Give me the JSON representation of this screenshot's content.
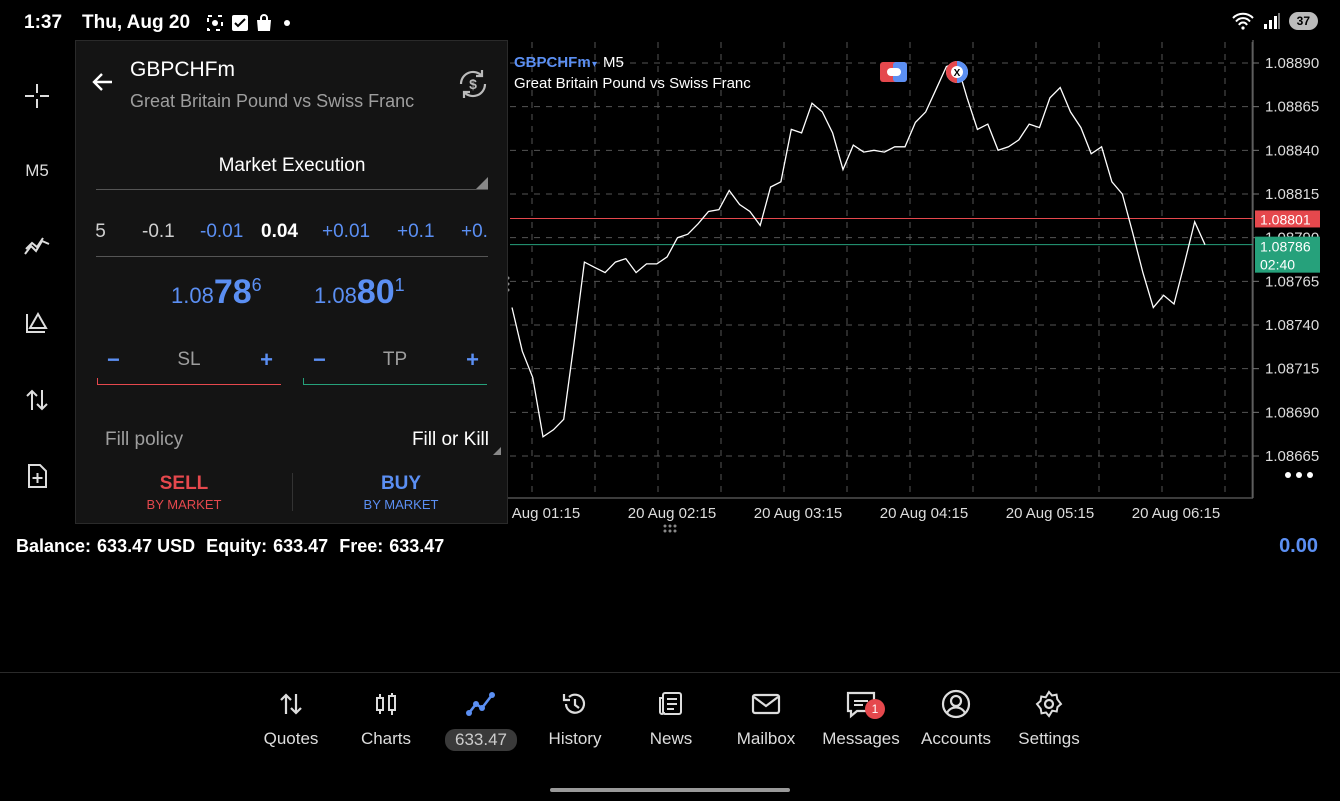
{
  "status_bar": {
    "time": "1:37",
    "date": "Thu, Aug 20",
    "battery": "37"
  },
  "toolbar": {
    "timeframe": "M5"
  },
  "order_panel": {
    "symbol": "GBPCHFm",
    "description": "Great Britain Pound vs Swiss Franc",
    "execution": "Market Execution",
    "volume_steps": [
      ".5",
      "-0.1",
      "-0.01",
      "0.04",
      "+0.01",
      "+0.1",
      "+0."
    ],
    "bid": {
      "prefix": "1.08",
      "big": "78",
      "sup": "6"
    },
    "ask": {
      "prefix": "1.08",
      "big": "80",
      "sup": "1"
    },
    "sl_label": "SL",
    "tp_label": "TP",
    "minus": "−",
    "plus": "+",
    "fill_policy_label": "Fill policy",
    "fill_policy_value": "Fill or Kill",
    "sell": {
      "label": "SELL",
      "sub": "BY MARKET"
    },
    "buy": {
      "label": "BUY",
      "sub": "BY MARKET"
    },
    "colors": {
      "sell": "#e5484d",
      "buy": "#5b8ff3",
      "sl": "#e5484d",
      "tp": "#26a17b"
    }
  },
  "chart_data": {
    "type": "line",
    "symbol": "GBPCHFm",
    "timeframe": "M5",
    "description": "Great Britain Pound vs Swiss Franc",
    "ylim": [
      1.08645,
      1.089
    ],
    "y_ticks": [
      "1.08890",
      "1.08865",
      "1.08840",
      "1.08815",
      "1.08790",
      "1.08765",
      "1.08740",
      "1.08715",
      "1.08690",
      "1.08665"
    ],
    "x_ticks": [
      "Aug 01:15",
      "20 Aug 02:15",
      "20 Aug 03:15",
      "20 Aug 04:15",
      "20 Aug 05:15",
      "20 Aug 06:15"
    ],
    "ask_price": "1.08801",
    "bid_price": "1.08786",
    "countdown": "02:40",
    "grid": true,
    "values": [
      1.0875,
      1.08725,
      1.0871,
      1.08676,
      1.0868,
      1.08686,
      1.0873,
      1.08776,
      1.08773,
      1.0877,
      1.08776,
      1.08778,
      1.0877,
      1.08775,
      1.08775,
      1.08779,
      1.0879,
      1.08792,
      1.08798,
      1.08805,
      1.08806,
      1.08817,
      1.08809,
      1.08805,
      1.08797,
      1.08819,
      1.08822,
      1.08852,
      1.0885,
      1.08867,
      1.08862,
      1.0885,
      1.08829,
      1.08843,
      1.08839,
      1.0884,
      1.08839,
      1.08842,
      1.08842,
      1.08856,
      1.08862,
      1.08875,
      1.08888,
      1.0889,
      1.0887,
      1.08852,
      1.08855,
      1.0884,
      1.08842,
      1.08846,
      1.08855,
      1.08853,
      1.0887,
      1.08876,
      1.08862,
      1.08853,
      1.08838,
      1.08842,
      1.08822,
      1.08815,
      1.08793,
      1.0877,
      1.0875,
      1.08757,
      1.08752,
      1.08775,
      1.08799,
      1.08786
    ]
  },
  "account": {
    "balance_label": "Balance:",
    "balance": "633.47 USD",
    "equity_label": "Equity:",
    "equity": "633.47",
    "free_label": "Free:",
    "free": "633.47",
    "profit": "0.00"
  },
  "nav": [
    {
      "label": "Quotes",
      "icon": "quotes-icon"
    },
    {
      "label": "Charts",
      "icon": "charts-icon"
    },
    {
      "label": "633.47",
      "icon": "trade-icon"
    },
    {
      "label": "History",
      "icon": "history-icon"
    },
    {
      "label": "News",
      "icon": "news-icon"
    },
    {
      "label": "Mailbox",
      "icon": "mailbox-icon"
    },
    {
      "label": "Messages",
      "icon": "messages-icon",
      "badge": "1"
    },
    {
      "label": "Accounts",
      "icon": "accounts-icon"
    },
    {
      "label": "Settings",
      "icon": "settings-icon"
    }
  ]
}
